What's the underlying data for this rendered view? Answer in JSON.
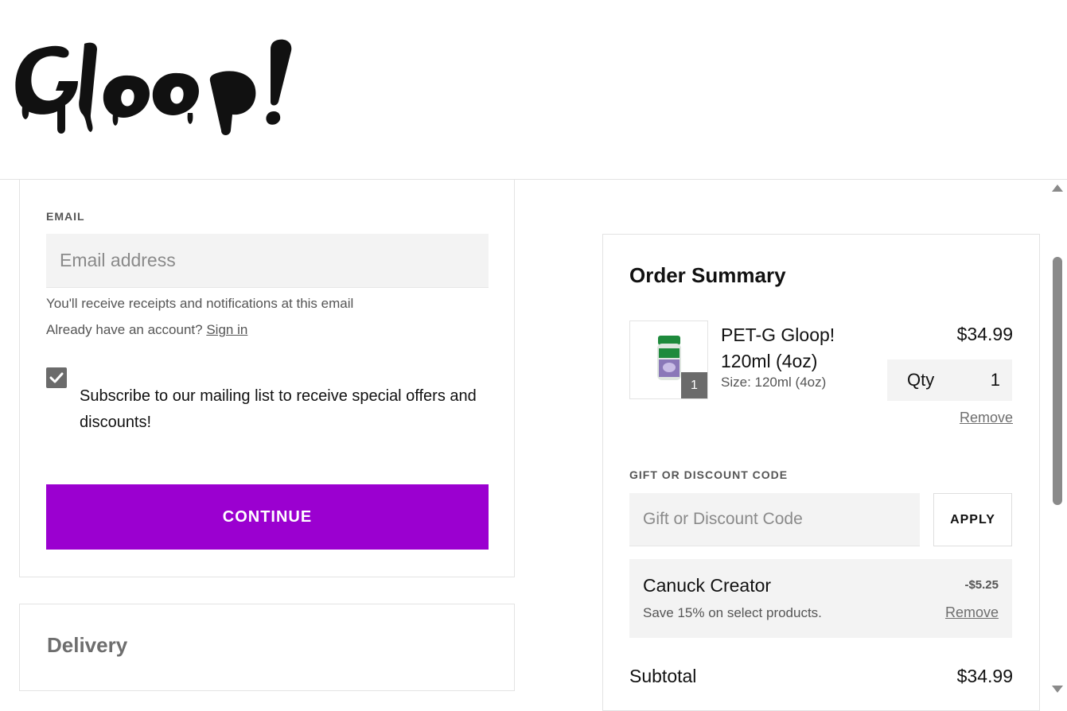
{
  "brand": {
    "logo_text": "Gloop!"
  },
  "contact": {
    "email_label": "EMAIL",
    "email_placeholder": "Email address",
    "email_value": "",
    "receipt_note": "You'll receive receipts and notifications at this email",
    "account_prompt": "Already have an account?",
    "sign_in_label": "Sign in",
    "subscribe_checked": true,
    "subscribe_label": "Subscribe to our mailing list to receive special offers and discounts!",
    "continue_label": "CONTINUE"
  },
  "delivery": {
    "title": "Delivery"
  },
  "summary": {
    "title": "Order Summary",
    "items": [
      {
        "name": "PET-G Gloop! 120ml (4oz)",
        "size": "Size: 120ml (4oz)",
        "price": "$34.99",
        "qty_label": "Qty",
        "qty": "1",
        "thumb_badge": "1",
        "remove_label": "Remove"
      }
    ],
    "discount_label": "GIFT OR DISCOUNT CODE",
    "discount_placeholder": "Gift or Discount Code",
    "apply_label": "APPLY",
    "promo": {
      "name": "Canuck Creator",
      "description": "Save 15% on select products.",
      "amount": "-$5.25",
      "remove_label": "Remove"
    },
    "subtotal_label": "Subtotal",
    "subtotal_value": "$34.99"
  },
  "colors": {
    "accent": "#9b00d0",
    "field_bg": "#f3f3f3",
    "muted_text": "#555555"
  }
}
